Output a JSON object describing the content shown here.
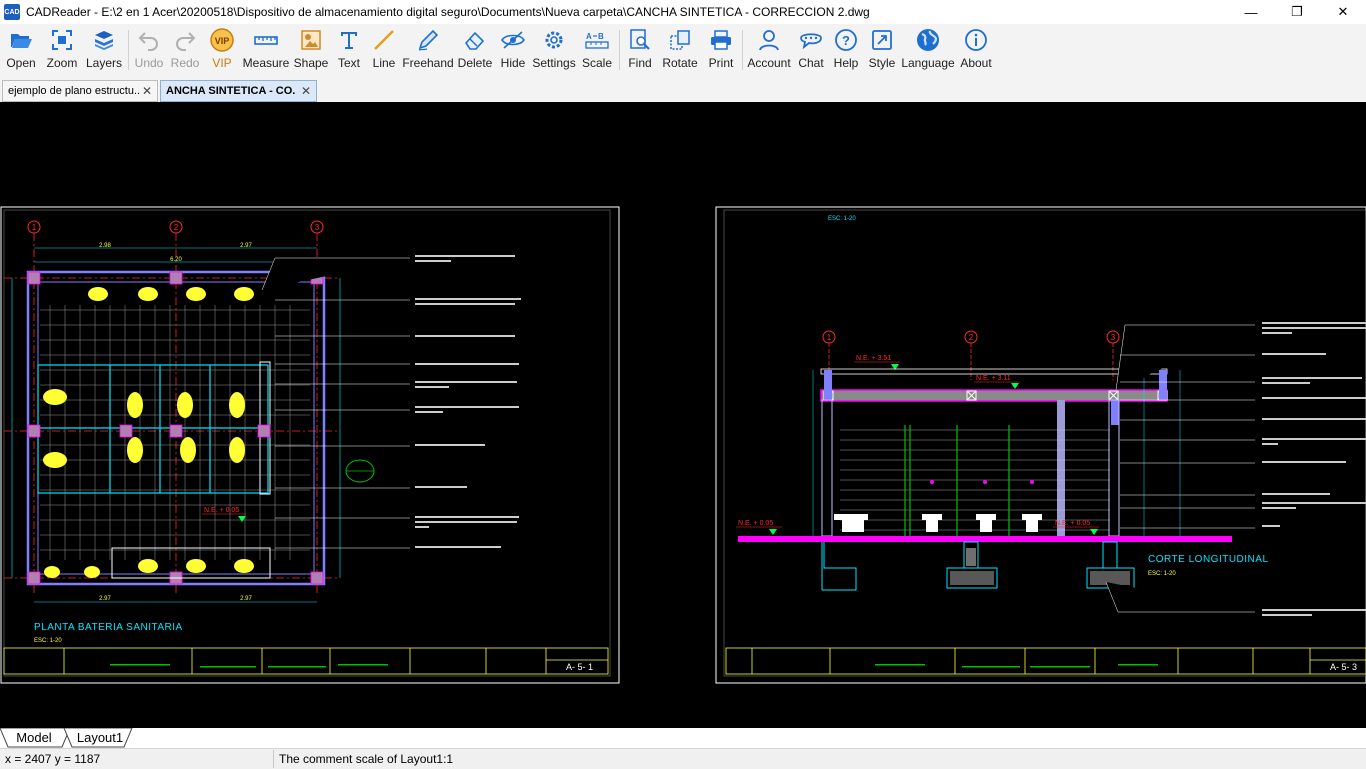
{
  "window": {
    "app_icon_text": "CAD",
    "title": "CADReader - E:\\2 en 1 Acer\\20200518\\Dispositivo de almacenamiento digital seguro\\Documents\\Nueva carpeta\\CANCHA SINTETICA - CORRECCION 2.dwg",
    "minimize": "—",
    "maximize": "❐",
    "close": "✕"
  },
  "toolbar": {
    "open": "Open",
    "zoom": "Zoom",
    "layers": "Layers",
    "undo": "Undo",
    "redo": "Redo",
    "vip": "VIP",
    "measure": "Measure",
    "shape": "Shape",
    "text": "Text",
    "line": "Line",
    "freehand": "Freehand",
    "delete": "Delete",
    "hide": "Hide",
    "settings": "Settings",
    "scale": "Scale",
    "find": "Find",
    "rotate": "Rotate",
    "print": "Print",
    "account": "Account",
    "chat": "Chat",
    "help": "Help",
    "style": "Style",
    "language": "Language",
    "about": "About"
  },
  "tabs": [
    {
      "label": "ejemplo de plano estructu..",
      "close": "✕"
    },
    {
      "label": "ANCHA SINTETICA - CO.",
      "close": "✕"
    }
  ],
  "drawing_left": {
    "grid_1": "1",
    "grid_2": "2",
    "grid_3": "3",
    "dim_top_1": "2.98",
    "dim_top_2": "2.97",
    "dim_total": "6.20",
    "dim_bottom_1": "2.97",
    "dim_bottom_2": "2.97",
    "level_mark": "N.E. + 0.05",
    "title": "PLANTA BATERIA SANITARIA",
    "scale": "ESC: 1-20",
    "sheet_number": "A- 5- 1"
  },
  "drawing_right": {
    "scale_top": "ESC: 1-20",
    "grid_1": "1",
    "grid_2": "2",
    "grid_3": "3",
    "level_1": "N.E. + 3.51",
    "level_2": "N.E. + 3.11",
    "level_3": "N.E. + 0.05",
    "level_4": "N.E. + 0.05",
    "title": "CORTE LONGITUDINAL",
    "scale": "ESC: 1-20",
    "sheet_number": "A- 5- 3"
  },
  "colors": {
    "cad_bg": "#000000",
    "grid_line": "#ff2a2a",
    "dim": "#00e5ff",
    "wall": "#8080ff",
    "magenta": "#ff00ff",
    "yellow": "#ffff33",
    "green": "#00c000",
    "white": "#ffffff"
  },
  "layout_tabs": {
    "model": "Model",
    "layout1": "Layout1"
  },
  "status": {
    "coords": "x = 2407 y = 1187",
    "message": "The comment scale of Layout1:1"
  }
}
